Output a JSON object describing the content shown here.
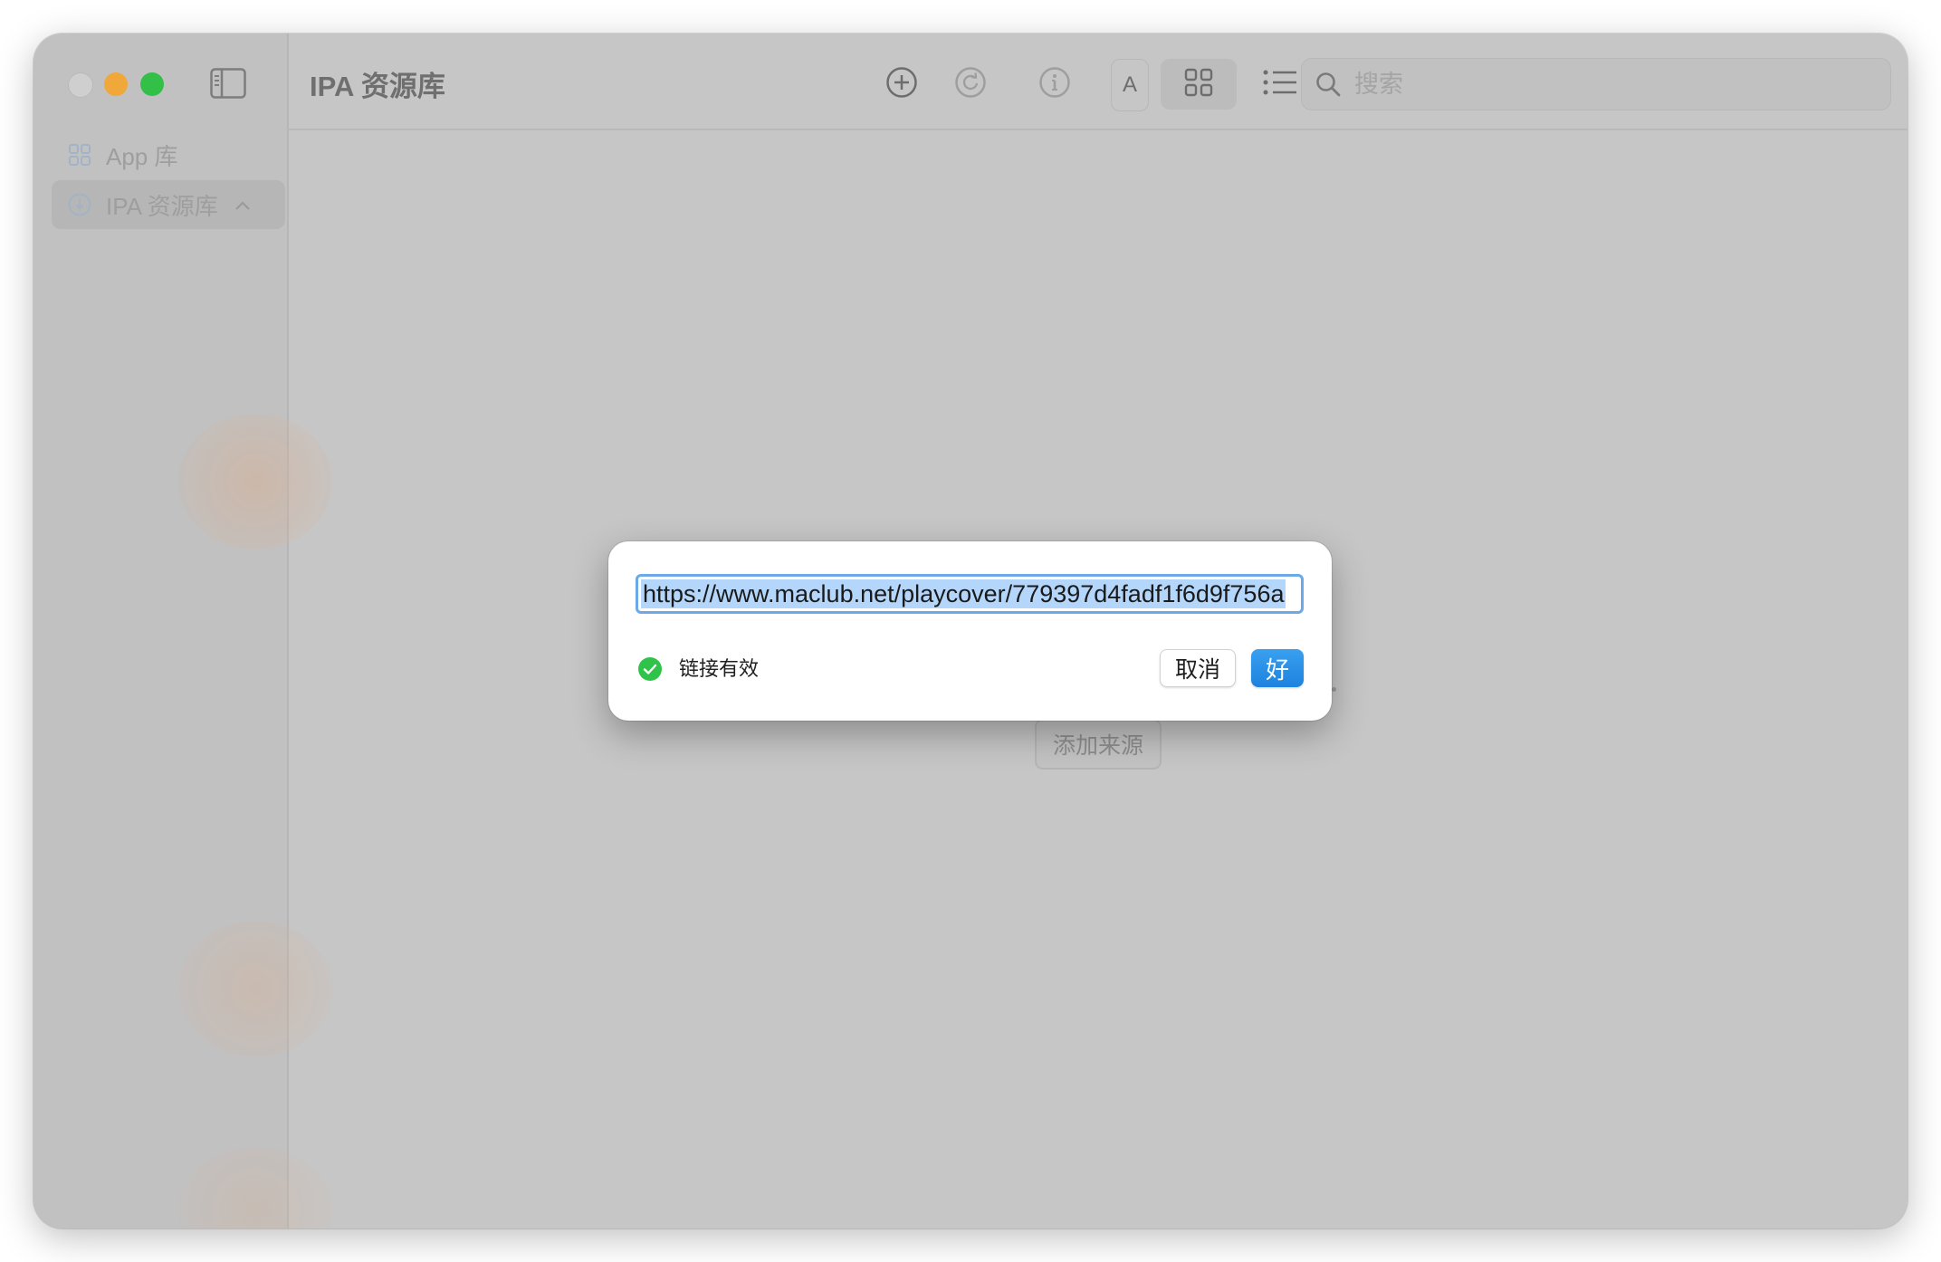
{
  "window": {
    "title": "IPA 资源库"
  },
  "sidebar": {
    "items": [
      {
        "label": "App 库",
        "icon": "grid-icon"
      },
      {
        "label": "IPA 资源库",
        "icon": "download-circle-icon",
        "chevron": "^"
      }
    ]
  },
  "toolbar": {
    "buttons": [
      "plus-circle-icon",
      "refresh-icon",
      "info-icon",
      "sort-alpha-icon",
      "grid-view-icon",
      "list-view-icon"
    ],
    "sort_label": "A",
    "search": {
      "placeholder": "搜索",
      "value": ""
    }
  },
  "main": {
    "add_source_label": "添加来源"
  },
  "dialog": {
    "url_value": "https://www.maclub.net/playcover/779397d4fadf1f6d9f756a",
    "status_text": "链接有效",
    "cancel_label": "取消",
    "ok_label": "好"
  },
  "colors": {
    "accent": "#1f86e0",
    "valid_green": "#2fc34a",
    "traffic_min": "#f0a83a",
    "traffic_max": "#33c048"
  }
}
